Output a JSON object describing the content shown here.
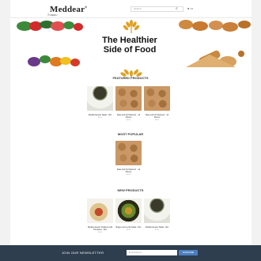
{
  "header": {
    "logo": "Meddear",
    "logo_sup": "®",
    "search_placeholder": "Search",
    "menu_label": "☰ MENU",
    "icons": [
      "search-icon",
      "user-icon",
      "cart-icon"
    ]
  },
  "hero": {
    "title_line1": "The Healthier",
    "title_line2": "Side of Food"
  },
  "sections": {
    "featured": "FEATURED PRODUCTS",
    "popular": "MOST POPULAR",
    "new": "NEW PRODUCTS"
  },
  "featured_products": [
    {
      "name": "Mediterranean Salad - 8oz",
      "price": "$0.00",
      "image": "tub"
    },
    {
      "name": "Date and Nut Mamoul - 12 Pieces",
      "price": "$0.00",
      "image": "dates"
    },
    {
      "name": "Date and Nut Mamoul - 12 Pieces",
      "price": "$0.00",
      "image": "dates"
    }
  ],
  "popular_products": [
    {
      "name": "Date and Nut Mamoul - 12 Pieces",
      "price": "$0.00",
      "image": "dates"
    }
  ],
  "new_products": [
    {
      "name": "Mediterranean Stuffed Lentil Tomatoes - 8oz",
      "price": "$0.00",
      "image": "plate"
    },
    {
      "name": "Bulgur and Lentil Salad - 8oz",
      "price": "$0.00",
      "image": "salad"
    },
    {
      "name": "Mediterranean Salad - 8oz",
      "price": "$0.00",
      "image": "tub"
    }
  ],
  "newsletter": {
    "label": "JOIN OUR NEWSLETTER",
    "placeholder": "Email Address",
    "button": "SUBSCRIBE"
  },
  "colors": {
    "footer_bg": "#2e3e4e",
    "subscribe_btn": "#4a7fc1",
    "wheat": "#e0a020"
  }
}
